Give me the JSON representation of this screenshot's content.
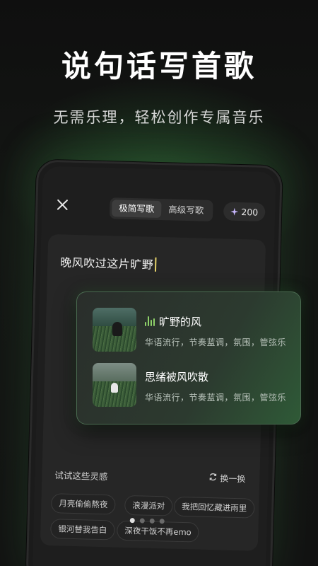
{
  "hero": {
    "title": "说句话写首歌",
    "subtitle": "无需乐理，轻松创作专属音乐"
  },
  "header": {
    "tabs": [
      {
        "label": "极简写歌",
        "active": true
      },
      {
        "label": "高级写歌",
        "active": false
      }
    ],
    "credits": "200"
  },
  "editor": {
    "text": "晚风吹过这片旷野"
  },
  "results": [
    {
      "title": "旷野的风",
      "tags": "华语流行，节奏蓝调，氛围，管弦乐",
      "playing": true
    },
    {
      "title": "思绪被风吹散",
      "tags": "华语流行，节奏蓝调，氛围，管弦乐",
      "playing": false
    }
  ],
  "inspiration": {
    "title": "试试这些灵感",
    "refresh_label": "换一换",
    "chips": [
      "月亮偷偷熬夜",
      "浪漫派对",
      "我把回忆藏进雨里",
      "银河替我告白",
      "深夜干饭不再emo"
    ],
    "page_count": 4,
    "active_page": 0
  },
  "colors": {
    "accent_green": "#8fd36a",
    "caret": "#e6d36a",
    "background": "#111111"
  }
}
